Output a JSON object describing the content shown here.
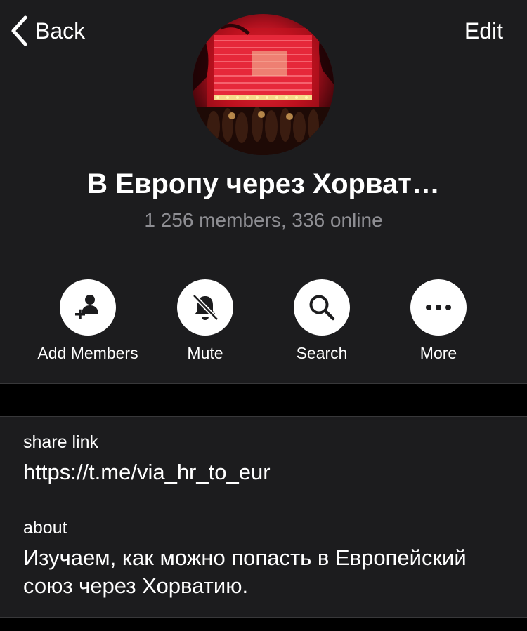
{
  "nav": {
    "back_label": "Back",
    "edit_label": "Edit"
  },
  "group": {
    "title": "В Европу через Хорват…",
    "subtitle": "1 256 members, 336 online"
  },
  "actions": [
    {
      "label": "Add Members",
      "icon": "add-member-icon"
    },
    {
      "label": "Mute",
      "icon": "bell-slash-icon"
    },
    {
      "label": "Search",
      "icon": "search-icon"
    },
    {
      "label": "More",
      "icon": "more-dots-icon"
    }
  ],
  "info": {
    "share_link": {
      "label": "share link",
      "value": "https://t.me/via_hr_to_eur"
    },
    "about": {
      "label": "about",
      "value": "Изучаем, как можно попасть в Европейский союз через Хорватию."
    }
  },
  "colors": {
    "background": "#000000",
    "panel": "#1c1c1e",
    "secondary_text": "#8e8e93",
    "separator": "#38383a"
  }
}
